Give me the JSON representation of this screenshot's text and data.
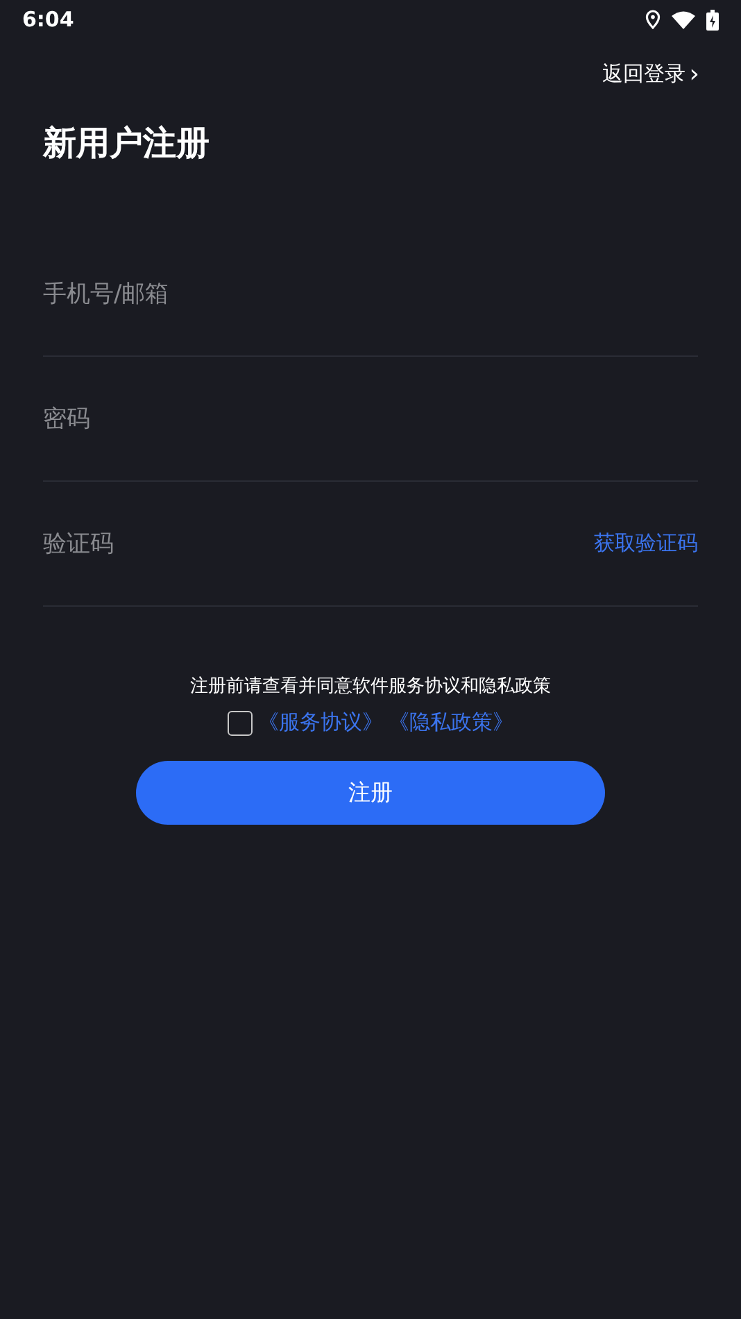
{
  "status_bar": {
    "time": "6:04"
  },
  "back_link": {
    "label": "返回登录",
    "chevron": "›"
  },
  "title": "新用户注册",
  "fields": [
    {
      "placeholder": "手机号/邮箱",
      "kind": "text"
    },
    {
      "placeholder": "密码",
      "kind": "password"
    },
    {
      "placeholder": "验证码",
      "kind": "code",
      "action": "获取验证码"
    }
  ],
  "agreement": {
    "notice": "注册前请查看并同意软件服务协议和隐私政策",
    "checked": false,
    "links": [
      "《服务协议》",
      "《隐私政策》"
    ]
  },
  "submit": "注册"
}
